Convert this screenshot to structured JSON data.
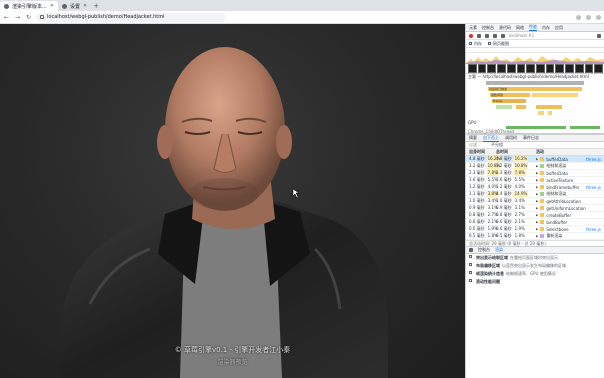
{
  "browser": {
    "tabs": [
      {
        "title": "渲染引擎版本...",
        "active": true
      },
      {
        "title": "设置",
        "active": false
      }
    ],
    "new_tab": "+",
    "address": "localhost/webgl-publish/demo/Headjacket.html"
  },
  "scene": {
    "watermark_line1": "© 草莓引擎v0.1 - 引擎开发者江小秦",
    "watermark_line2": "渲染器预览"
  },
  "devtools": {
    "top_tabs": [
      "元素",
      "控制台",
      "源代码",
      "网络",
      "性能",
      "内存",
      "应用"
    ],
    "active_top_tab": "性能",
    "profile_select": "localhost #1",
    "options": [
      "内存",
      "网页截图"
    ],
    "main_track_label": "主要 — http://localhost/webgl-publish/demo/Headjacket.html",
    "flame_labels": [
      "任务",
      "动画帧已触发",
      "函数调用",
      "Frame"
    ],
    "gpu_label": "GPU",
    "thread_label": "Chrome_ChildIOThread",
    "bottom_tabs": [
      "摘要",
      "自下而上",
      "调用树",
      "事件日志"
    ],
    "active_bottom_tab": "自下而上",
    "filter": "过滤",
    "group_by": "不分组",
    "columns": {
      "self": "自身时间",
      "total": "总时间",
      "activity": "活动"
    },
    "rows": [
      {
        "self": "4.8 毫秒",
        "self_pct": "16.2%",
        "total": "4.8 毫秒",
        "total_pct": "16.2%",
        "activity": "bufferData",
        "color": "#f6c55a",
        "hot": true,
        "selected": true,
        "source": "three.js"
      },
      {
        "self": "3.2 毫秒",
        "self_pct": "10.8%",
        "total": "3.2 毫秒",
        "total_pct": "10.8%",
        "activity": "绘制和渲染",
        "color": "#9fd08f",
        "hot": true,
        "selected": false,
        "source": ""
      },
      {
        "self": "2.3 毫秒",
        "self_pct": "7.8%",
        "total": "2.3 毫秒",
        "total_pct": "7.8%",
        "activity": "bufferData",
        "color": "#f6c55a",
        "hot": true,
        "selected": false,
        "source": ""
      },
      {
        "self": "1.6 毫秒",
        "self_pct": "5.5%",
        "total": "1.6 毫秒",
        "total_pct": "5.5%",
        "activity": "activeTexture",
        "color": "#f6c55a",
        "hot": false,
        "selected": false,
        "source": ""
      },
      {
        "self": "1.2 毫秒",
        "self_pct": "4.0%",
        "total": "1.2 毫秒",
        "total_pct": "4.0%",
        "activity": "bindFramebuffer",
        "color": "#f6c55a",
        "hot": false,
        "selected": false,
        "source": "three.js"
      },
      {
        "self": "1.1 毫秒",
        "self_pct": "3.8%",
        "total": "4.4 毫秒",
        "total_pct": "14.9%",
        "activity": "绘制和渲染",
        "color": "#9fd08f",
        "hot": true,
        "selected": false,
        "source": ""
      },
      {
        "self": "1.0 毫秒",
        "self_pct": "3.4%",
        "total": "1.0 毫秒",
        "total_pct": "3.4%",
        "activity": "getAttribLocation",
        "color": "#f6c55a",
        "hot": false,
        "selected": false,
        "source": ""
      },
      {
        "self": "0.9 毫秒",
        "self_pct": "3.1%",
        "total": "0.9 毫秒",
        "total_pct": "3.1%",
        "activity": "getUniformLocation",
        "color": "#f6c55a",
        "hot": false,
        "selected": false,
        "source": ""
      },
      {
        "self": "0.8 毫秒",
        "self_pct": "2.7%",
        "total": "0.8 毫秒",
        "total_pct": "2.7%",
        "activity": "createBuffer",
        "color": "#f6c55a",
        "hot": false,
        "selected": false,
        "source": ""
      },
      {
        "self": "0.6 毫秒",
        "self_pct": "2.1%",
        "total": "0.6 毫秒",
        "total_pct": "2.1%",
        "activity": "bindBuffer",
        "color": "#f6c55a",
        "hot": false,
        "selected": false,
        "source": ""
      },
      {
        "self": "0.6 毫秒",
        "self_pct": "1.9%",
        "total": "0.6 毫秒",
        "total_pct": "1.9%",
        "activity": "Selectbone",
        "color": "#f6c55a",
        "hot": false,
        "selected": false,
        "source": "three.js"
      },
      {
        "self": "0.5 毫秒",
        "self_pct": "1.8%",
        "total": "0.5 毫秒",
        "total_pct": "1.8%",
        "activity": "重新渲染",
        "color": "#c4a8e8",
        "hot": false,
        "selected": false,
        "source": ""
      }
    ],
    "summary": "总活动时间: 29 毫秒 (0 毫秒 - 总 29 毫秒)",
    "drawer_tabs": [
      "控制台",
      "渲染"
    ],
    "render_items": [
      {
        "title": "突出显示绘制区域",
        "desc": "在重绘页面区域时突出显示"
      },
      {
        "title": "布局偏移区域",
        "desc": "以蓝色突出显示发生布局偏移的区域"
      },
      {
        "title": "帧渲染统计信息",
        "desc": "绘制帧速率、GPU 使用情况"
      },
      {
        "title": "滚动性能问题",
        "desc": ""
      }
    ]
  }
}
